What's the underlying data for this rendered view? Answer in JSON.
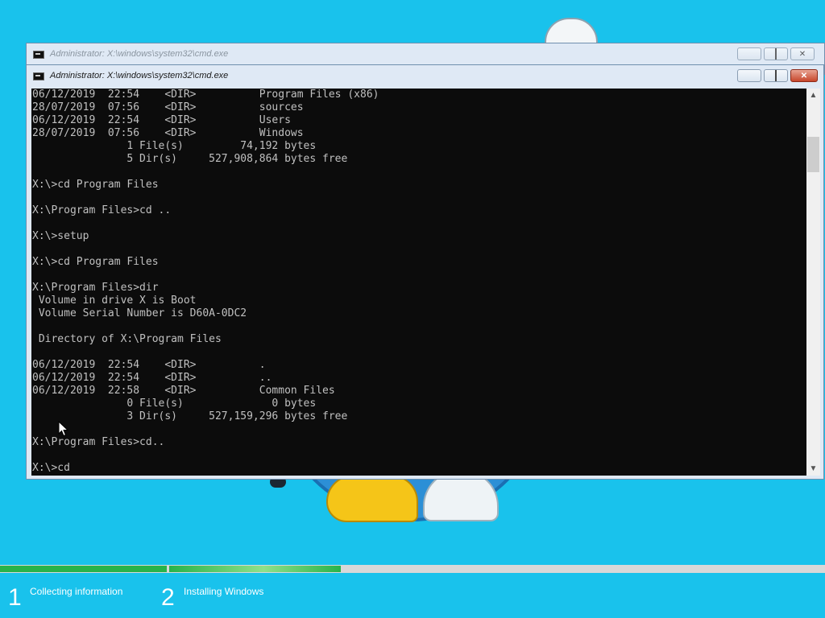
{
  "colors": {
    "desktop_bg": "#19c2ec",
    "console_bg": "#0c0c0c",
    "console_text": "#c0c0c0",
    "progress_fill": "#28b34a"
  },
  "windows": {
    "back": {
      "title": "Administrator: X:\\windows\\system32\\cmd.exe",
      "icon": "cmd-icon"
    },
    "front": {
      "title": "Administrator: X:\\windows\\system32\\cmd.exe",
      "icon": "cmd-icon",
      "console_text": "06/12/2019  22:54    <DIR>          Program Files (x86)\n28/07/2019  07:56    <DIR>          sources\n06/12/2019  22:54    <DIR>          Users\n28/07/2019  07:56    <DIR>          Windows\n               1 File(s)         74,192 bytes\n               5 Dir(s)     527,908,864 bytes free\n\nX:\\>cd Program Files\n\nX:\\Program Files>cd ..\n\nX:\\>setup\n\nX:\\>cd Program Files\n\nX:\\Program Files>dir\n Volume in drive X is Boot\n Volume Serial Number is D60A-0DC2\n\n Directory of X:\\Program Files\n\n06/12/2019  22:54    <DIR>          .\n06/12/2019  22:54    <DIR>          ..\n06/12/2019  22:58    <DIR>          Common Files\n               0 File(s)              0 bytes\n               3 Dir(s)     527,159,296 bytes free\n\nX:\\Program Files>cd..\n\nX:\\>cd"
    }
  },
  "setup": {
    "steps": [
      {
        "number": "1",
        "label": "Collecting information",
        "progress": 1.0
      },
      {
        "number": "2",
        "label": "Installing Windows",
        "progress": 1.0
      }
    ],
    "overall_progress_percent": 41
  }
}
